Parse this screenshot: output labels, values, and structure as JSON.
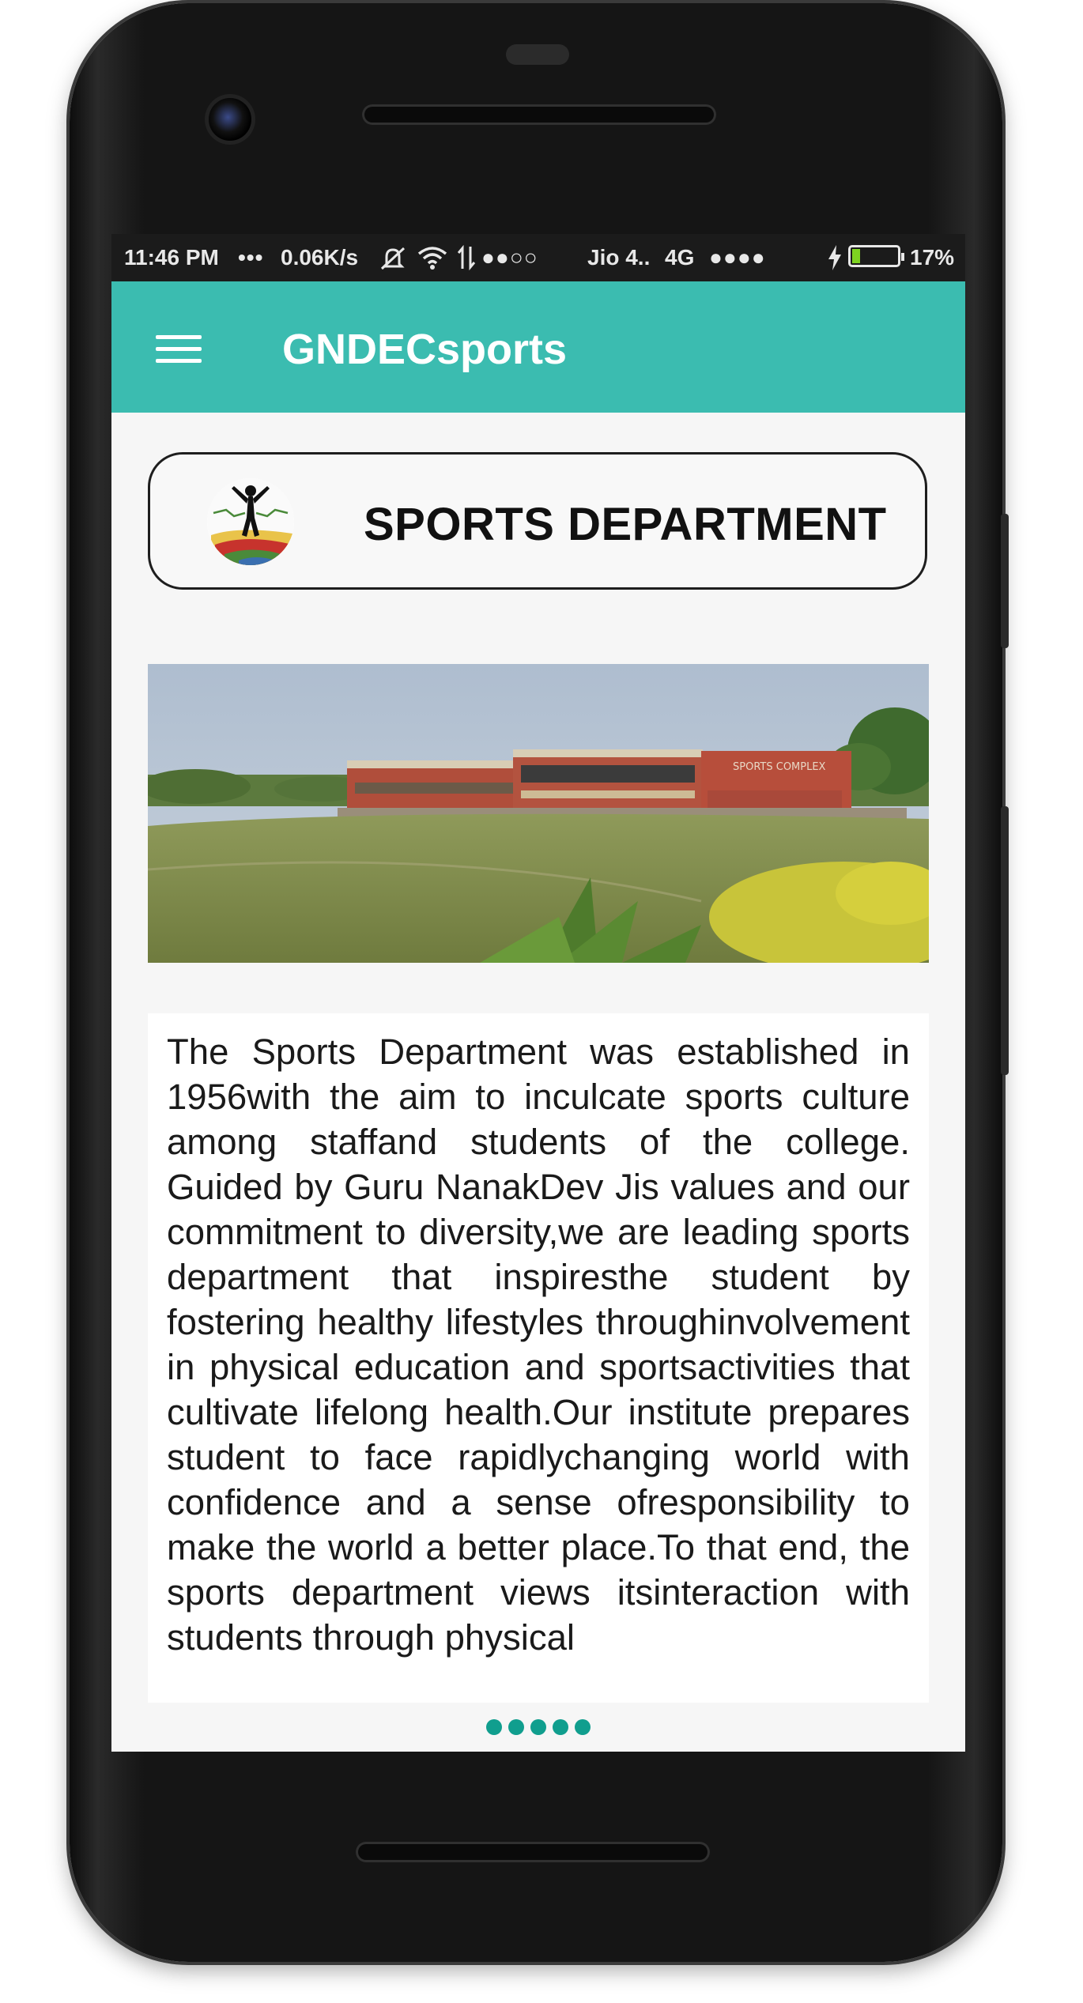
{
  "status_bar": {
    "time": "11:46 PM",
    "more": "•••",
    "speed": "0.06K/s",
    "signal1": "●●○○",
    "carrier": "Jio 4..",
    "network": "4G",
    "signal2": "●●●●",
    "battery": "17%",
    "battery_level": 0.17
  },
  "app_bar": {
    "title": "GNDECsports",
    "menu_icon": "hamburger-menu-icon"
  },
  "header_card": {
    "title": "SPORTS DEPARTMENT",
    "logo_icon": "runner-logo-icon"
  },
  "photo": {
    "sign_text": "SPORTS COMPLEX"
  },
  "description": "The Sports Department was established in 1956with the aim to inculcate sports culture among staffand students of the college. Guided by Guru NanakDev Jis values and our commitment to diversity,we are leading sports department that inspiresthe student by fostering healthy lifestyles throughinvolvement in physical education and sportsactivities that cultivate lifelong health.Our institute prepares student to face rapidlychanging world with confidence and a sense ofresponsibility to make the world a better place.To that end, the sports department views itsinteraction with students through physical",
  "pager": {
    "count": 5
  },
  "colors": {
    "app_bar": "#3bbcb0",
    "pager_dot": "#109e8e",
    "status_bar": "#1b1b1b"
  }
}
